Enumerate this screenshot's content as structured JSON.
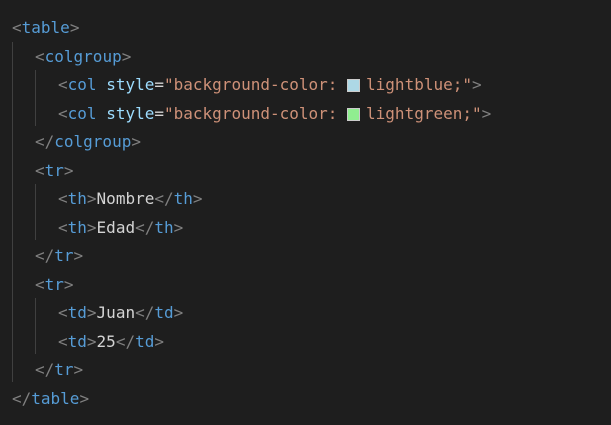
{
  "editor": {
    "lines": [
      {
        "indent": 0,
        "open": "<",
        "tag": "table",
        "close": ">"
      },
      {
        "indent": 1,
        "open": "<",
        "tag": "colgroup",
        "close": ">"
      },
      {
        "indent": 2,
        "open": "<",
        "tag": "col",
        "attr": "style",
        "eq": "=",
        "q1": "\"",
        "val1": "background-color: ",
        "swatch_color": "#add8e6",
        "val2": "lightblue;",
        "q2": "\"",
        "close": ">"
      },
      {
        "indent": 2,
        "open": "<",
        "tag": "col",
        "attr": "style",
        "eq": "=",
        "q1": "\"",
        "val1": "background-color: ",
        "swatch_color": "#90ee90",
        "val2": "lightgreen;",
        "q2": "\"",
        "close": ">"
      },
      {
        "indent": 1,
        "open": "</",
        "tag": "colgroup",
        "close": ">"
      },
      {
        "indent": 1,
        "open": "<",
        "tag": "tr",
        "close": ">"
      },
      {
        "indent": 2,
        "open": "<",
        "tag": "th",
        "close": ">",
        "text": "Nombre",
        "open2": "</",
        "tag2": "th",
        "close2": ">"
      },
      {
        "indent": 2,
        "open": "<",
        "tag": "th",
        "close": ">",
        "text": "Edad",
        "open2": "</",
        "tag2": "th",
        "close2": ">"
      },
      {
        "indent": 1,
        "open": "</",
        "tag": "tr",
        "close": ">"
      },
      {
        "indent": 1,
        "open": "<",
        "tag": "tr",
        "close": ">"
      },
      {
        "indent": 2,
        "open": "<",
        "tag": "td",
        "close": ">",
        "text": "Juan",
        "open2": "</",
        "tag2": "td",
        "close2": ">"
      },
      {
        "indent": 2,
        "open": "<",
        "tag": "td",
        "close": ">",
        "text": "25",
        "open2": "</",
        "tag2": "td",
        "close2": ">"
      },
      {
        "indent": 1,
        "open": "</",
        "tag": "tr",
        "close": ">"
      },
      {
        "indent": 0,
        "open": "</",
        "tag": "table",
        "close": ">"
      }
    ]
  }
}
